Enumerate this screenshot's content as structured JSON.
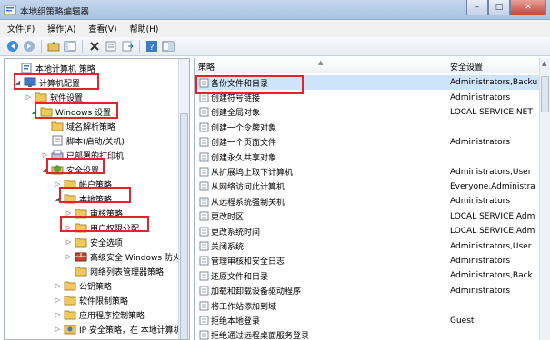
{
  "window": {
    "title": "本地组策略编辑器",
    "minimize": "–",
    "maximize": "□",
    "close": "✕"
  },
  "menu": [
    "文件(F)",
    "操作(A)",
    "查看(V)",
    "帮助(H)"
  ],
  "toolbar_icons": [
    "back-icon",
    "forward-icon",
    "up-folder-icon",
    "console-icon",
    "delete-icon",
    "properties-icon",
    "export-icon",
    "help-icon",
    "console-tree-icon"
  ],
  "tree": [
    {
      "label": "本地计算机 策略",
      "icon": "policy-root-icon",
      "expander": ""
    },
    {
      "label": "计算机配置",
      "icon": "computer-icon",
      "expander": "◢"
    },
    {
      "label": "软件设置",
      "icon": "folder-icon",
      "expander": "▷"
    },
    {
      "label": "Windows 设置",
      "icon": "folder-icon",
      "expander": "◢"
    },
    {
      "label": "域名解析策略",
      "icon": "folder-icon",
      "expander": ""
    },
    {
      "label": "脚本(启动/关机)",
      "icon": "script-icon",
      "expander": ""
    },
    {
      "label": "已部署的打印机",
      "icon": "printer-icon",
      "expander": "▷"
    },
    {
      "label": "安全设置",
      "icon": "security-icon",
      "expander": "◢"
    },
    {
      "label": "帐户策略",
      "icon": "folder-icon",
      "expander": "▷"
    },
    {
      "label": "本地策略",
      "icon": "folder-icon",
      "expander": "◢"
    },
    {
      "label": "审核策略",
      "icon": "folder-icon",
      "expander": "▷"
    },
    {
      "label": "用户权限分配",
      "icon": "folder-icon",
      "expander": "▷"
    },
    {
      "label": "安全选项",
      "icon": "folder-icon",
      "expander": "▷"
    },
    {
      "label": "高级安全 Windows 防火墙",
      "icon": "firewall-icon",
      "expander": "▷"
    },
    {
      "label": "网络列表管理器策略",
      "icon": "folder-icon",
      "expander": ""
    },
    {
      "label": "公钥策略",
      "icon": "folder-icon",
      "expander": "▷"
    },
    {
      "label": "软件限制策略",
      "icon": "folder-icon",
      "expander": "▷"
    },
    {
      "label": "应用程序控制策略",
      "icon": "folder-icon",
      "expander": "▷"
    },
    {
      "label": "IP 安全策略，在 本地计算机",
      "icon": "ipsec-icon",
      "expander": "▷"
    },
    {
      "label": "高级审核策略配置",
      "icon": "folder-icon",
      "expander": "▷"
    }
  ],
  "list": {
    "col_policy": "策略",
    "col_setting": "安全设置",
    "rows": [
      {
        "policy": "备份文件和目录",
        "setting": "Administrators,Backu"
      },
      {
        "policy": "创建符号链接",
        "setting": "Administrators"
      },
      {
        "policy": "创建全局对象",
        "setting": "LOCAL SERVICE,NET"
      },
      {
        "policy": "创建一个令牌对象",
        "setting": ""
      },
      {
        "policy": "创建一个页面文件",
        "setting": "Administrators"
      },
      {
        "policy": "创建永久共享对象",
        "setting": ""
      },
      {
        "policy": "从扩展坞上取下计算机",
        "setting": "Administrators,User"
      },
      {
        "policy": "从网络访问此计算机",
        "setting": "Everyone,Administra"
      },
      {
        "policy": "从远程系统强制关机",
        "setting": "Administrators"
      },
      {
        "policy": "更改时区",
        "setting": "LOCAL SERVICE,Adm"
      },
      {
        "policy": "更改系统时间",
        "setting": "LOCAL SERVICE,Adm"
      },
      {
        "policy": "关闭系统",
        "setting": "Administrators,User"
      },
      {
        "policy": "管理审核和安全日志",
        "setting": "Administrators"
      },
      {
        "policy": "还原文件和目录",
        "setting": "Administrators,Back"
      },
      {
        "policy": "加载和卸载设备驱动程序",
        "setting": "Administrators"
      },
      {
        "policy": "将工作站添加到域",
        "setting": ""
      },
      {
        "policy": "拒绝本地登录",
        "setting": "Guest"
      },
      {
        "policy": "拒绝通过远程桌面服务登录",
        "setting": ""
      }
    ]
  },
  "colors": {
    "highlight": "#e3242b",
    "selection": "#cde4fb"
  }
}
